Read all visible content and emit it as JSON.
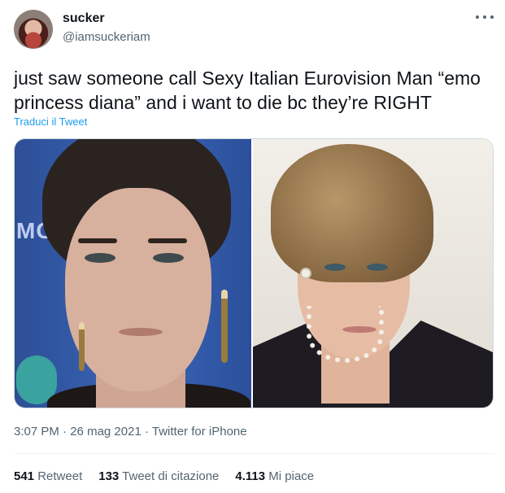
{
  "author": {
    "name": "sucker",
    "handle": "@iamsuckeriam"
  },
  "tweet": {
    "text": "just saw someone call Sexy Italian Eurovision Man “emo princess diana” and i want to die bc they’re RIGHT",
    "translate_label": "Traduci il Tweet"
  },
  "media": {
    "left_photo_sign_text": "MC"
  },
  "meta": {
    "time": "3:07 PM",
    "date": "26 mag 2021",
    "client": "Twitter for iPhone",
    "separator": "·"
  },
  "stats": {
    "retweets_count": "541",
    "retweets_label": "Retweet",
    "quotes_count": "133",
    "quotes_label": "Tweet di citazione",
    "likes_count": "4.113",
    "likes_label": "Mi piace"
  },
  "colors": {
    "link": "#1d9bf0",
    "secondary_text": "#536471",
    "primary_text": "#0f1419"
  },
  "icons": {
    "more": "more-horizontal-icon"
  }
}
